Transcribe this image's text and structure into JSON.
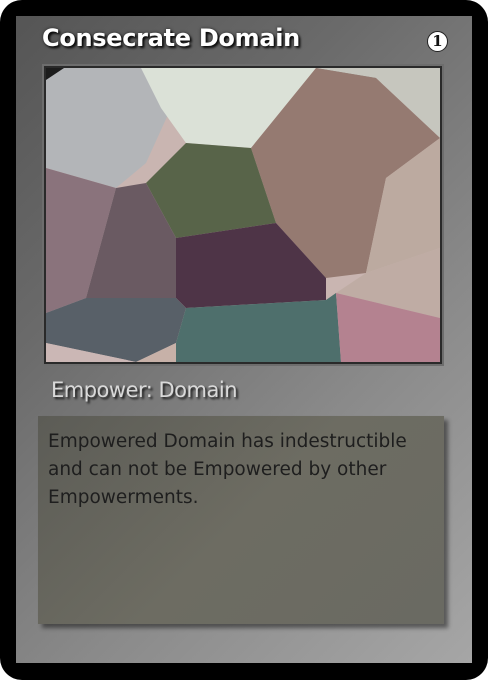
{
  "card": {
    "title": "Consecrate Domain",
    "cost": "1",
    "type_line": "Empower: Domain",
    "rules_text": "Empowered Domain has indestructible and can not be Empowered by other Empowerments."
  },
  "art": {
    "palette": [
      "#b3b5b8",
      "#dbe1d7",
      "#957a71",
      "#858d82",
      "#586449",
      "#8a737c",
      "#6a5a62",
      "#4e3447",
      "#bcaaa0",
      "#586068",
      "#4e6f6c",
      "#b48290",
      "#cbb7b5"
    ]
  }
}
